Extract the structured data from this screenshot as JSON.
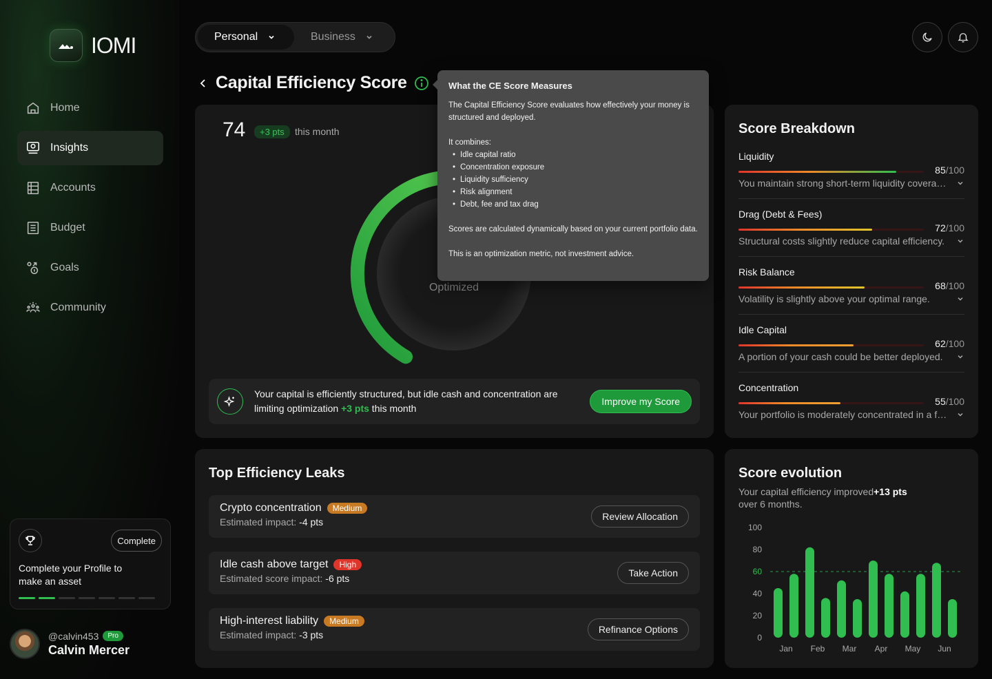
{
  "app": {
    "name": "IOMI"
  },
  "nav": [
    {
      "label": "Home",
      "icon": "home-icon"
    },
    {
      "label": "Insights",
      "icon": "insights-icon",
      "active": true
    },
    {
      "label": "Accounts",
      "icon": "accounts-icon"
    },
    {
      "label": "Budget",
      "icon": "budget-icon"
    },
    {
      "label": "Goals",
      "icon": "goals-icon"
    },
    {
      "label": "Community",
      "icon": "community-icon"
    }
  ],
  "profile_card": {
    "button": "Complete",
    "text": "Complete your Profile to make an asset",
    "progress_done": 2,
    "progress_total": 7
  },
  "user": {
    "handle": "@calvin453",
    "badge": "Pro",
    "name": "Calvin Mercer"
  },
  "switcher": {
    "options": [
      "Personal",
      "Business"
    ],
    "selected": "Personal"
  },
  "page": {
    "title": "Capital Efficiency Score"
  },
  "score": {
    "value": "74",
    "delta": "+3 pts",
    "period": "this month",
    "status": "Optimized",
    "fraction": 0.74
  },
  "tooltip": {
    "title": "What the CE Score Measures",
    "intro": "The Capital Efficiency Score evaluates how effectively your money is structured and deployed.",
    "combines_label": "It combines:",
    "items": [
      "Idle capital ratio",
      "Concentration exposure",
      "Liquidity sufficiency",
      "Risk alignment",
      "Debt, fee and tax drag"
    ],
    "dynamic": "Scores are calculated dynamically based on your current portfolio data.",
    "disclaimer": "This is an optimization metric, not investment advice."
  },
  "insight": {
    "text_before": "Your capital is efficiently structured, but idle cash and concentration are limiting optimization ",
    "highlight": "+3 pts",
    "text_after": " this month",
    "button": "Improve my Score"
  },
  "breakdown": {
    "title": "Score Breakdown",
    "max_label": "/100",
    "items": [
      {
        "name": "Liquidity",
        "score": "85",
        "value": 85,
        "desc": "You maintain strong short-term liquidity coverage."
      },
      {
        "name": "Drag (Debt & Fees)",
        "score": "72",
        "value": 72,
        "desc": "Structural costs slightly reduce capital efficiency."
      },
      {
        "name": "Risk Balance",
        "score": "68",
        "value": 68,
        "desc": "Volatility is slightly above your optimal range."
      },
      {
        "name": "Idle Capital",
        "score": "62",
        "value": 62,
        "desc": "A portion of your cash could be better deployed."
      },
      {
        "name": "Concentration",
        "score": "55",
        "value": 55,
        "desc": "Your portfolio is moderately concentrated in a fe..."
      }
    ]
  },
  "leaks": {
    "title": "Top Efficiency Leaks",
    "items": [
      {
        "name": "Crypto concentration",
        "severity": "Medium",
        "severity_color": "#c87a22",
        "impact_label": "Estimated impact:",
        "impact": "-4 pts",
        "action": "Review Allocation"
      },
      {
        "name": "Idle cash above target",
        "severity": "High",
        "severity_color": "#e0352b",
        "impact_label": "Estimated score impact:",
        "impact": "-6 pts",
        "action": "Take Action"
      },
      {
        "name": "High-interest liability",
        "severity": "Medium",
        "severity_color": "#c87a22",
        "impact_label": "Estimated impact:",
        "impact": "-3 pts",
        "action": "Refinance Options"
      }
    ]
  },
  "evolution": {
    "title": "Score evolution",
    "sub_before": "Your capital efficiency improved",
    "sub_highlight": "+13 pts",
    "sub_after": " over 6 months."
  },
  "chart_data": {
    "type": "bar",
    "ylim": [
      0,
      100
    ],
    "yticks": [
      0,
      20,
      40,
      60,
      80,
      100
    ],
    "xticks": [
      "Jan",
      "Feb",
      "Mar",
      "Apr",
      "May",
      "Jun"
    ],
    "reference_line": 60,
    "values": [
      45,
      58,
      82,
      36,
      52,
      35,
      70,
      58,
      42,
      58,
      68,
      35
    ],
    "bar_color": "#2fbe4f"
  },
  "colors": {
    "accent": "#2fbe4f",
    "bar_gradient_start": "#e0352b",
    "bar_gradient_end": "#2fbe4f"
  }
}
